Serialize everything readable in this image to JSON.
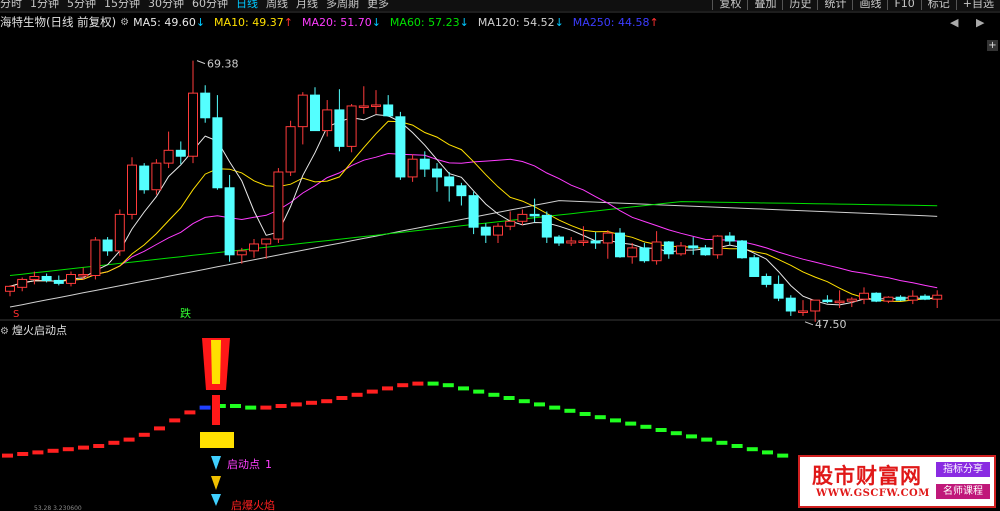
{
  "toolbar": {
    "periods": [
      "分时",
      "1分钟",
      "5分钟",
      "15分钟",
      "30分钟",
      "60分钟",
      "日线",
      "周线",
      "月线",
      "多周期",
      "更多"
    ],
    "active_period": "日线",
    "tools": [
      "复权",
      "叠加",
      "历史",
      "统计",
      "画线",
      "F10",
      "标记"
    ],
    "add_self": "+自选"
  },
  "legend": {
    "title": "海特生物(日线 前复权)",
    "ma": [
      {
        "label": "MA5: 49.60",
        "dir": "↓",
        "color": "#e8e8e8"
      },
      {
        "label": "MA10: 49.37",
        "dir": "↑",
        "color": "#ffe000"
      },
      {
        "label": "MA20: 51.70",
        "dir": "↓",
        "color": "#ff3cff"
      },
      {
        "label": "MA60: 57.23",
        "dir": "↓",
        "color": "#00e000"
      },
      {
        "label": "MA120: 54.52",
        "dir": "↓",
        "color": "#d0d0d0"
      },
      {
        "label": "MA250: 44.58",
        "dir": "↑",
        "color": "#3c3cff"
      }
    ]
  },
  "price_annotations": {
    "high": "69.38",
    "low": "47.50",
    "buy_mark": "S",
    "sell_mark": "跌"
  },
  "indicator": {
    "title": "煌火启动点",
    "label_start": "启动点",
    "label_end": "1",
    "label_fire": "启爆火焰",
    "bottom_value": "53.28 3.230600"
  },
  "side": {
    "plus": "+",
    "left_arrow": "◀",
    "right_arrow": "▶"
  },
  "watermark": {
    "main": "股市财富网",
    "url": "WWW.GSCFW.COM",
    "tag1": "指标分享",
    "tag2": "名师课程"
  },
  "colors": {
    "up": "#ff3b3b",
    "down": "#54ffff",
    "ma5": "#e8e8e8",
    "ma10": "#ffe000",
    "ma20": "#ff3cff",
    "ma60": "#00e000",
    "ma120": "#d0d0d0"
  },
  "chart_data": {
    "type": "candlestick",
    "price_axis": {
      "ymin": 44,
      "ymax": 72
    },
    "candles": [
      [
        45.9,
        46.5,
        45.4,
        46.4
      ],
      [
        46.3,
        47.3,
        45.9,
        47.1
      ],
      [
        47.1,
        47.9,
        46.6,
        47.4
      ],
      [
        47.4,
        47.7,
        46.8,
        47.0
      ],
      [
        47.0,
        47.5,
        46.5,
        46.7
      ],
      [
        46.7,
        47.9,
        46.4,
        47.6
      ],
      [
        47.6,
        48.3,
        47.1,
        47.6
      ],
      [
        47.5,
        51.4,
        47.1,
        51.1
      ],
      [
        51.1,
        51.4,
        49.5,
        50.0
      ],
      [
        50.0,
        54.2,
        49.5,
        53.7
      ],
      [
        53.7,
        59.5,
        53.2,
        58.7
      ],
      [
        58.6,
        58.9,
        55.8,
        56.2
      ],
      [
        56.2,
        59.3,
        55.7,
        58.9
      ],
      [
        58.9,
        62.1,
        58.4,
        60.2
      ],
      [
        60.2,
        61.1,
        58.8,
        59.6
      ],
      [
        59.6,
        69.3,
        58.9,
        66.0
      ],
      [
        66.0,
        66.8,
        63.0,
        63.5
      ],
      [
        63.5,
        65.8,
        56.2,
        56.4
      ],
      [
        56.4,
        57.7,
        48.9,
        49.6
      ],
      [
        49.6,
        50.3,
        48.7,
        50.0
      ],
      [
        50.0,
        51.2,
        49.3,
        50.7
      ],
      [
        50.7,
        51.2,
        49.2,
        51.2
      ],
      [
        51.2,
        58.4,
        50.8,
        58.0
      ],
      [
        58.0,
        63.2,
        57.6,
        62.6
      ],
      [
        62.6,
        66.1,
        60.8,
        65.8
      ],
      [
        65.8,
        66.6,
        62.2,
        62.2
      ],
      [
        62.2,
        65.3,
        61.6,
        64.3
      ],
      [
        64.3,
        66.4,
        60.1,
        60.6
      ],
      [
        60.6,
        64.9,
        60.0,
        64.7
      ],
      [
        64.7,
        66.7,
        63.9,
        64.7
      ],
      [
        64.7,
        66.3,
        63.9,
        64.8
      ],
      [
        64.8,
        65.8,
        63.6,
        63.7
      ],
      [
        63.6,
        64.1,
        57.2,
        57.5
      ],
      [
        57.5,
        59.8,
        57.0,
        59.3
      ],
      [
        59.3,
        60.1,
        57.5,
        58.3
      ],
      [
        58.3,
        58.9,
        56.0,
        57.5
      ],
      [
        57.5,
        58.0,
        55.0,
        56.6
      ],
      [
        56.6,
        56.9,
        54.6,
        55.6
      ],
      [
        55.6,
        56.0,
        51.7,
        52.4
      ],
      [
        52.4,
        52.8,
        50.8,
        51.6
      ],
      [
        51.6,
        52.8,
        50.8,
        52.5
      ],
      [
        52.5,
        54.0,
        52.1,
        53.0
      ],
      [
        53.0,
        54.2,
        52.6,
        53.7
      ],
      [
        53.7,
        55.3,
        52.9,
        53.6
      ],
      [
        53.6,
        54.0,
        50.8,
        51.4
      ],
      [
        51.4,
        51.6,
        50.5,
        50.8
      ],
      [
        50.8,
        51.4,
        50.5,
        51.0
      ],
      [
        51.0,
        52.5,
        50.5,
        51.0
      ],
      [
        51.0,
        51.9,
        50.2,
        50.8
      ],
      [
        50.8,
        52.1,
        49.2,
        51.8
      ],
      [
        51.8,
        52.3,
        49.3,
        49.4
      ],
      [
        49.4,
        50.8,
        48.7,
        50.3
      ],
      [
        50.3,
        50.8,
        48.8,
        49.0
      ],
      [
        49.0,
        52.0,
        48.6,
        50.9
      ],
      [
        50.9,
        51.0,
        49.2,
        49.7
      ],
      [
        49.7,
        50.9,
        49.5,
        50.5
      ],
      [
        50.5,
        51.4,
        49.6,
        50.3
      ],
      [
        50.3,
        50.6,
        49.5,
        49.6
      ],
      [
        49.6,
        51.6,
        49.2,
        51.5
      ],
      [
        51.5,
        51.9,
        50.6,
        51.0
      ],
      [
        51.0,
        51.1,
        49.2,
        49.3
      ],
      [
        49.3,
        49.6,
        47.4,
        47.4
      ],
      [
        47.4,
        47.7,
        46.3,
        46.6
      ],
      [
        46.6,
        47.5,
        44.9,
        45.2
      ],
      [
        45.2,
        45.5,
        43.4,
        43.9
      ],
      [
        43.9,
        45.0,
        43.4,
        43.9
      ],
      [
        43.9,
        45.0,
        42.8,
        45.0
      ],
      [
        45.0,
        45.5,
        44.7,
        44.9
      ],
      [
        44.9,
        46.0,
        44.2,
        44.9
      ],
      [
        44.9,
        45.3,
        44.3,
        45.1
      ],
      [
        45.1,
        46.3,
        44.6,
        45.7
      ],
      [
        45.7,
        45.8,
        44.8,
        44.9
      ],
      [
        44.9,
        45.4,
        44.7,
        45.3
      ],
      [
        45.3,
        45.5,
        44.9,
        45.0
      ],
      [
        45.0,
        46.0,
        44.6,
        45.4
      ],
      [
        45.4,
        45.6,
        45.0,
        45.1
      ],
      [
        45.1,
        46.0,
        44.2,
        45.5
      ]
    ],
    "indicator_steps": [
      [
        4,
        "r"
      ],
      [
        5,
        "r"
      ],
      [
        6,
        "r"
      ],
      [
        7,
        "r"
      ],
      [
        8,
        "r"
      ],
      [
        9,
        "r"
      ],
      [
        10,
        "r"
      ],
      [
        12,
        "r"
      ],
      [
        14,
        "r"
      ],
      [
        17,
        "r"
      ],
      [
        21,
        "r"
      ],
      [
        26,
        "r"
      ],
      [
        31,
        "r"
      ],
      [
        34,
        "b"
      ],
      [
        35,
        "g"
      ],
      [
        35,
        "g"
      ],
      [
        34,
        "g"
      ],
      [
        34,
        "r"
      ],
      [
        35,
        "r"
      ],
      [
        36,
        "r"
      ],
      [
        37,
        "r"
      ],
      [
        38,
        "r"
      ],
      [
        40,
        "r"
      ],
      [
        42,
        "r"
      ],
      [
        44,
        "r"
      ],
      [
        46,
        "r"
      ],
      [
        48,
        "r"
      ],
      [
        49,
        "r"
      ],
      [
        49,
        "g"
      ],
      [
        48,
        "g"
      ],
      [
        46,
        "g"
      ],
      [
        44,
        "g"
      ],
      [
        42,
        "g"
      ],
      [
        40,
        "g"
      ],
      [
        38,
        "g"
      ],
      [
        36,
        "g"
      ],
      [
        34,
        "g"
      ],
      [
        32,
        "g"
      ],
      [
        30,
        "g"
      ],
      [
        28,
        "g"
      ],
      [
        26,
        "g"
      ],
      [
        24,
        "g"
      ],
      [
        22,
        "g"
      ],
      [
        20,
        "g"
      ],
      [
        18,
        "g"
      ],
      [
        16,
        "g"
      ],
      [
        14,
        "g"
      ],
      [
        12,
        "g"
      ],
      [
        10,
        "g"
      ],
      [
        8,
        "g"
      ],
      [
        6,
        "g"
      ],
      [
        4,
        "g"
      ]
    ]
  }
}
